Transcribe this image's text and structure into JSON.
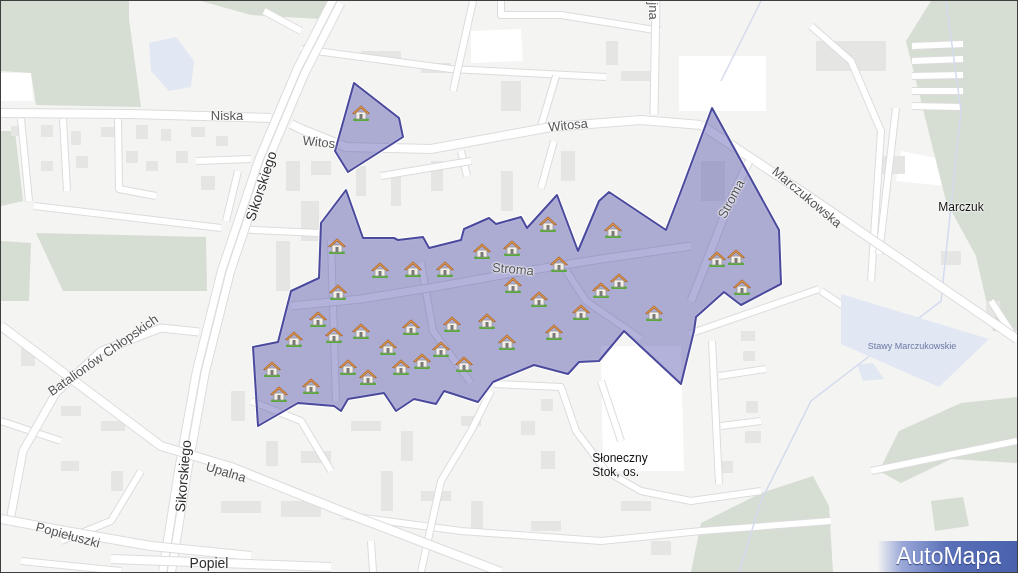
{
  "map": {
    "labels": [
      {
        "kind": "street",
        "text": "jna"
      },
      {
        "kind": "street",
        "text": "Niska"
      },
      {
        "kind": "street",
        "text": "Witos"
      },
      {
        "kind": "street",
        "text": "Witosa"
      },
      {
        "kind": "main_street",
        "text": "Sikorskiego"
      },
      {
        "kind": "street",
        "text": "Marczukowska"
      },
      {
        "kind": "street",
        "text": "Stroma"
      },
      {
        "kind": "place",
        "text": "Marczuk"
      },
      {
        "kind": "street",
        "text": "Stroma"
      },
      {
        "kind": "street",
        "text": "Batalionów Chłopskich"
      },
      {
        "kind": "water",
        "text": "Stawy Marczukowskie"
      },
      {
        "kind": "place",
        "text": "Słoneczny Stok, os."
      },
      {
        "kind": "main_street",
        "text": "Sikorskiego"
      },
      {
        "kind": "street",
        "text": "Upalna"
      },
      {
        "kind": "street",
        "text": "Popiełuszki"
      },
      {
        "kind": "main_street",
        "text": "Popiel"
      }
    ],
    "logo": "AutoMapa"
  }
}
